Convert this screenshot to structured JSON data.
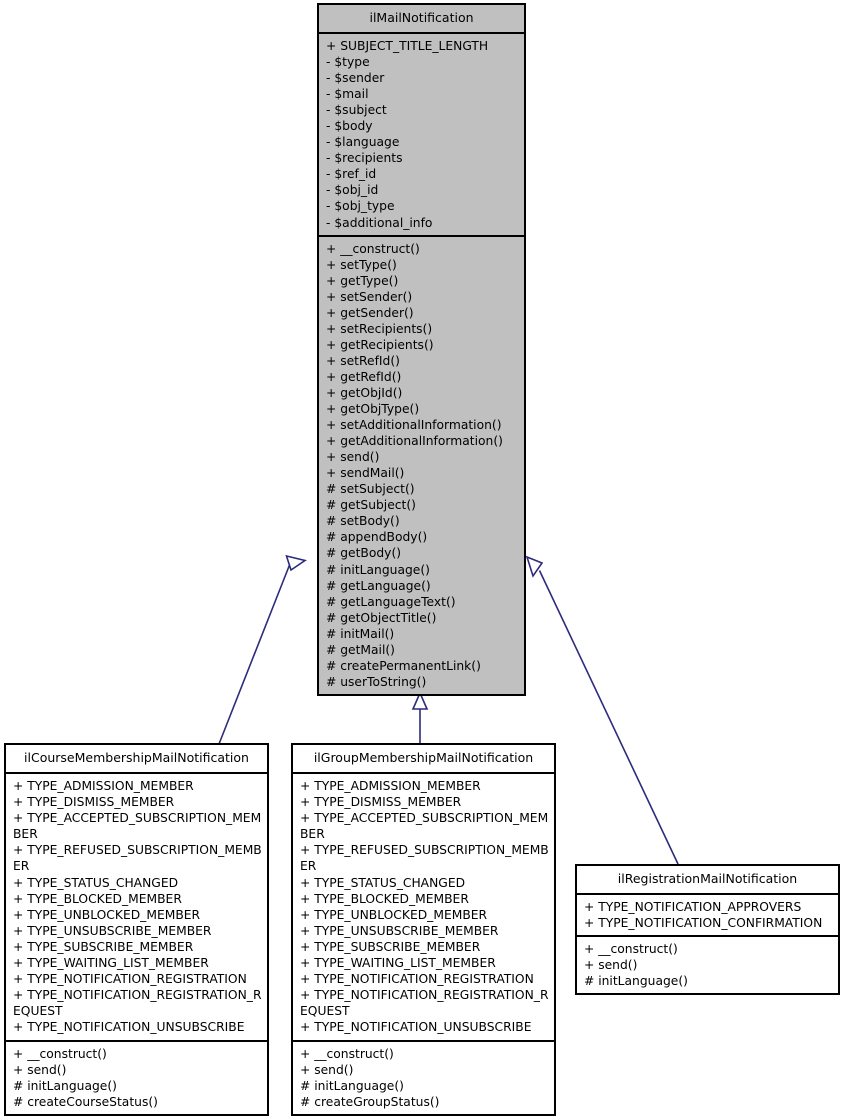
{
  "diagram": {
    "type": "uml-class-inheritance",
    "background_color": "#ffffff",
    "base_class_fill": "#c0c0c0",
    "subclass_fill": "#ffffff",
    "border_color": "#000000",
    "edge_color": "#2c2c7c"
  },
  "classes": {
    "base": {
      "name": "ilMailNotification",
      "attributes": [
        "+ SUBJECT_TITLE_LENGTH",
        "- $type",
        "- $sender",
        "- $mail",
        "- $subject",
        "- $body",
        "- $language",
        "- $recipients",
        "- $ref_id",
        "- $obj_id",
        "- $obj_type",
        "- $additional_info"
      ],
      "methods": [
        "+ __construct()",
        "+ setType()",
        "+ getType()",
        "+ setSender()",
        "+ getSender()",
        "+ setRecipients()",
        "+ getRecipients()",
        "+ setRefId()",
        "+ getRefId()",
        "+ getObjId()",
        "+ getObjType()",
        "+ setAdditionalInformation()",
        "+ getAdditionalInformation()",
        "+ send()",
        "+ sendMail()",
        "# setSubject()",
        "# getSubject()",
        "# setBody()",
        "# appendBody()",
        "# getBody()",
        "# initLanguage()",
        "# getLanguage()",
        "# getLanguageText()",
        "# getObjectTitle()",
        "# initMail()",
        "# getMail()",
        "# createPermanentLink()",
        "# userToString()"
      ]
    },
    "course": {
      "name": "ilCourseMembershipMailNotification",
      "attributes": [
        "+ TYPE_ADMISSION_MEMBER",
        "+ TYPE_DISMISS_MEMBER",
        "+ TYPE_ACCEPTED_SUBSCRIPTION_MEMBER",
        "+ TYPE_REFUSED_SUBSCRIPTION_MEMBER",
        "+ TYPE_STATUS_CHANGED",
        "+ TYPE_BLOCKED_MEMBER",
        "+ TYPE_UNBLOCKED_MEMBER",
        "+ TYPE_UNSUBSCRIBE_MEMBER",
        "+ TYPE_SUBSCRIBE_MEMBER",
        "+ TYPE_WAITING_LIST_MEMBER",
        "+ TYPE_NOTIFICATION_REGISTRATION",
        "+ TYPE_NOTIFICATION_REGISTRATION_REQUEST",
        "+ TYPE_NOTIFICATION_UNSUBSCRIBE"
      ],
      "methods": [
        "+ __construct()",
        "+ send()",
        "# initLanguage()",
        "# createCourseStatus()"
      ]
    },
    "group": {
      "name": "ilGroupMembershipMailNotification",
      "attributes": [
        "+ TYPE_ADMISSION_MEMBER",
        "+ TYPE_DISMISS_MEMBER",
        "+ TYPE_ACCEPTED_SUBSCRIPTION_MEMBER",
        "+ TYPE_REFUSED_SUBSCRIPTION_MEMBER",
        "+ TYPE_STATUS_CHANGED",
        "+ TYPE_BLOCKED_MEMBER",
        "+ TYPE_UNBLOCKED_MEMBER",
        "+ TYPE_UNSUBSCRIBE_MEMBER",
        "+ TYPE_SUBSCRIBE_MEMBER",
        "+ TYPE_WAITING_LIST_MEMBER",
        "+ TYPE_NOTIFICATION_REGISTRATION",
        "+ TYPE_NOTIFICATION_REGISTRATION_REQUEST",
        "+ TYPE_NOTIFICATION_UNSUBSCRIBE"
      ],
      "methods": [
        "+ __construct()",
        "+ send()",
        "# initLanguage()",
        "# createGroupStatus()"
      ]
    },
    "registration": {
      "name": "ilRegistrationMailNotification",
      "attributes": [
        "+ TYPE_NOTIFICATION_APPROVERS",
        "+ TYPE_NOTIFICATION_CONFIRMATION"
      ],
      "methods": [
        "+ __construct()",
        "+ send()",
        "# initLanguage()"
      ]
    }
  },
  "edges": [
    {
      "from": "course",
      "to": "base",
      "kind": "inheritance"
    },
    {
      "from": "group",
      "to": "base",
      "kind": "inheritance"
    },
    {
      "from": "registration",
      "to": "base",
      "kind": "inheritance"
    }
  ]
}
